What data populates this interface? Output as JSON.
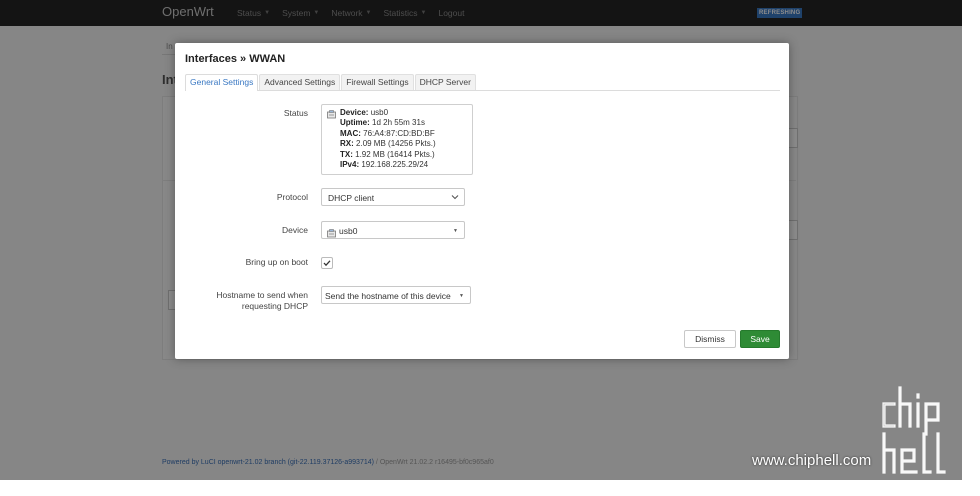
{
  "navbar": {
    "brand": "OpenWrt",
    "menu": [
      {
        "label": "Status",
        "has_caret": true
      },
      {
        "label": "System",
        "has_caret": true
      },
      {
        "label": "Network",
        "has_caret": true
      },
      {
        "label": "Statistics",
        "has_caret": true
      },
      {
        "label": "Logout",
        "has_caret": false
      }
    ],
    "badge": "REFRESHING",
    "badge_color": "#3a78c3"
  },
  "background": {
    "tab_label": "In",
    "heading": "Int"
  },
  "footer": {
    "link_text": "Powered by LuCI openwrt-21.02 branch (git-22.119.37126-a993714)",
    "separator": "/",
    "muted_text": "OpenWrt 21.02.2 r16495-bf0c965af0"
  },
  "modal": {
    "title": "Interfaces » WWAN",
    "tabs": [
      {
        "label": "General Settings",
        "active": true
      },
      {
        "label": "Advanced Settings",
        "active": false
      },
      {
        "label": "Firewall Settings",
        "active": false
      },
      {
        "label": "DHCP Server",
        "active": false
      }
    ],
    "status": {
      "label": "Status",
      "icon": "ethernet-port-icon",
      "lines": [
        {
          "key": "Device:",
          "value": "usb0"
        },
        {
          "key": "Uptime:",
          "value": "1d 2h 55m 31s"
        },
        {
          "key": "MAC:",
          "value": "76:A4:87:CD:BD:BF"
        },
        {
          "key": "RX:",
          "value": "2.09 MB (14256 Pkts.)"
        },
        {
          "key": "TX:",
          "value": "1.92 MB (16414 Pkts.)"
        },
        {
          "key": "IPv4:",
          "value": "192.168.225.29/24"
        }
      ]
    },
    "protocol": {
      "label": "Protocol",
      "value": "DHCP client"
    },
    "device": {
      "label": "Device",
      "value": "usb0",
      "icon": "ethernet-port-icon"
    },
    "bring_up": {
      "label": "Bring up on boot",
      "checked": true
    },
    "hostname": {
      "label_line1": "Hostname to send when",
      "label_line2": "requesting DHCP",
      "value": "Send the hostname of this device"
    },
    "buttons": {
      "dismiss": "Dismiss",
      "save": "Save",
      "save_color": "#2e8b35"
    }
  },
  "watermark": {
    "logo_text": "chip hell",
    "url": "www.chiphell.com"
  }
}
